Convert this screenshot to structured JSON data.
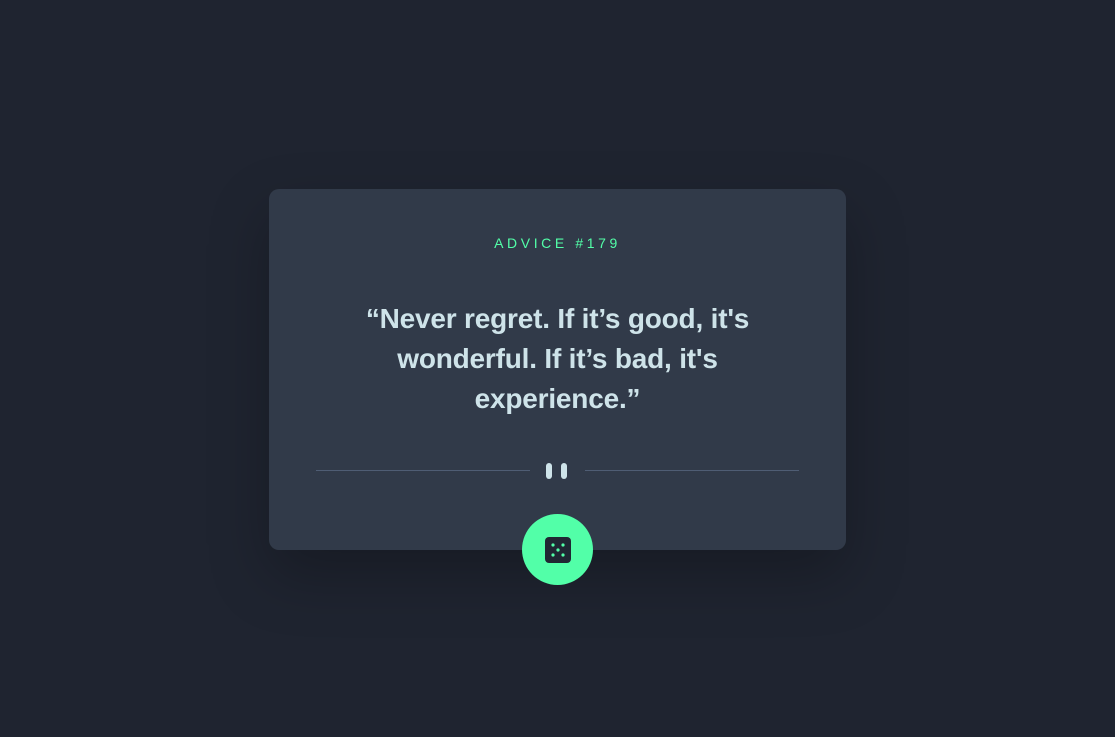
{
  "advice": {
    "id_label": "ADVICE #179",
    "quote": "“Never regret. If it’s good, it's wonderful. If it’s bad, it's experience.”"
  },
  "divider": {
    "icon": "pause-icon"
  },
  "button": {
    "icon": "dice-icon",
    "aria_label": "Generate new advice"
  },
  "colors": {
    "background": "#1f2430",
    "card": "#313a49",
    "accent": "#52ffa8",
    "text": "#cee3e9",
    "divider": "#4f5d74"
  }
}
